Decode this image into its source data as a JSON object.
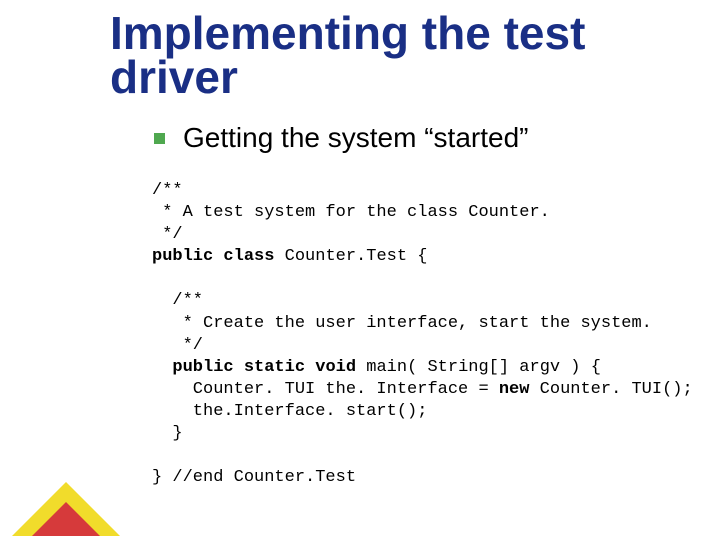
{
  "title": "Implementing the test driver",
  "bullet": "Getting the system “started”",
  "code": {
    "l01": "/**",
    "l02": " * A test system for the class Counter.",
    "l03": " */",
    "kw_public1": "public",
    "kw_class": "class",
    "l04_tail": " Counter.Test {",
    "l05": "",
    "l06": "  /**",
    "l07": "   * Create the user interface, start the system.",
    "l08": "   */",
    "indent2": "  ",
    "kw_public2": "public",
    "kw_static": "static",
    "kw_void": "void",
    "l09_tail": " main( String[] argv ) {",
    "l10a": "    Counter. TUI the. Interface = ",
    "kw_new": "new",
    "l10b": " Counter. TUI();",
    "l11": "    the.Interface. start();",
    "l12": "  }",
    "l13": "",
    "l14": "} //end Counter.Test"
  }
}
